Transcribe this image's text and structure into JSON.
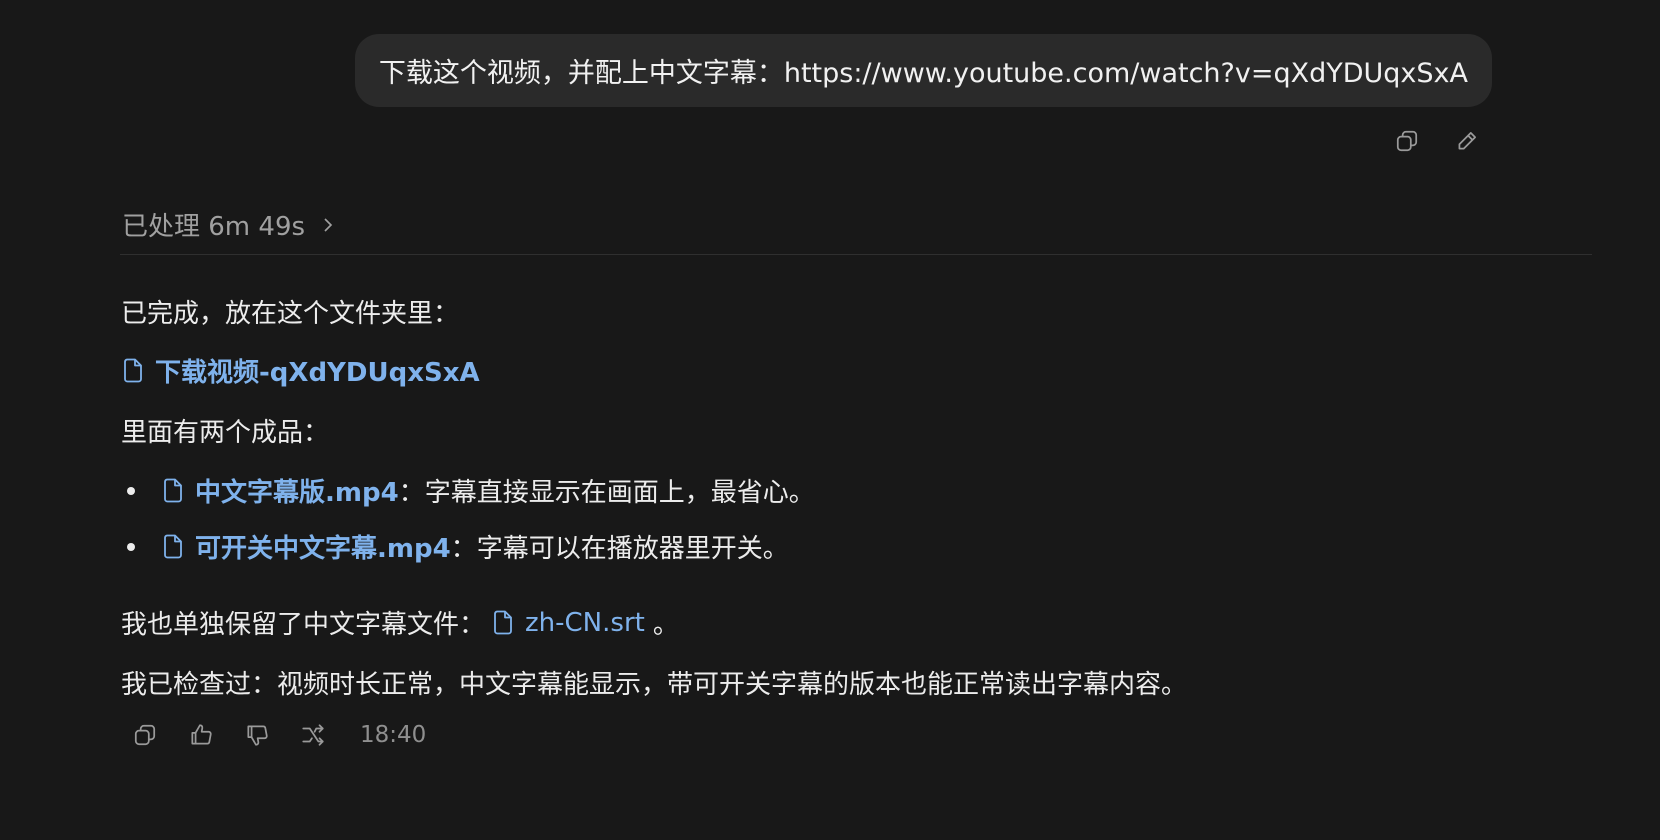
{
  "user_message": {
    "text": "下载这个视频，并配上中文字幕：https://www.youtube.com/watch?v=qXdYDUqxSxA",
    "actions": [
      "copy-icon",
      "edit-icon"
    ]
  },
  "assistant": {
    "processed_label": "已处理 6m 49s",
    "intro": "已完成，放在这个文件夹里：",
    "folder_link": "下载视频-qXdYDUqxSxA",
    "contents_intro": "里面有两个成品：",
    "products": [
      {
        "file": "中文字幕版.mp4",
        "sep": "：",
        "desc": "字幕直接显示在画面上，最省心。"
      },
      {
        "file": "可开关中文字幕.mp4",
        "sep": "：",
        "desc": "字幕可以在播放器里开关。"
      }
    ],
    "srt_line_prefix": "我也单独保留了中文字幕文件：",
    "srt_file": "zh-CN.srt",
    "srt_line_suffix": "。",
    "check_line": "我已检查过：视频时长正常，中文字幕能显示，带可开关字幕的版本也能正常读出字幕内容。",
    "timestamp": "18:40",
    "actions": [
      "copy-icon",
      "thumbs-up-icon",
      "thumbs-down-icon",
      "share-icon"
    ]
  },
  "colors": {
    "background": "#181818",
    "bubble": "#2a2a2a",
    "link": "#7fb2ec",
    "muted": "#a0a0a0"
  }
}
